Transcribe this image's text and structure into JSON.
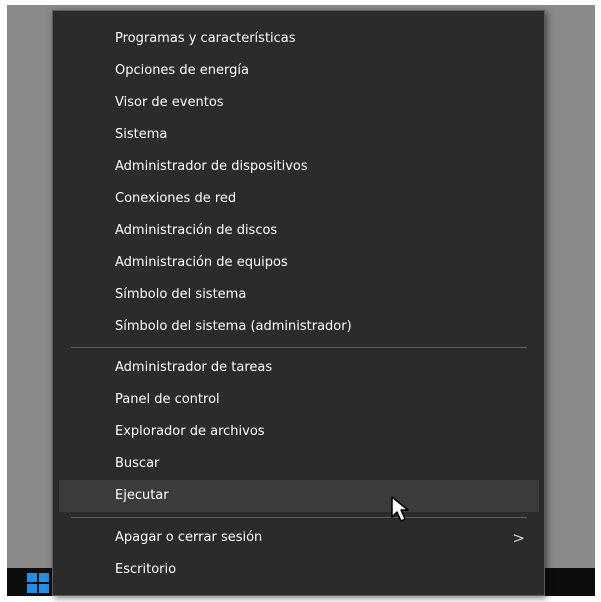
{
  "menu": {
    "group1": [
      {
        "label": "Programas y características"
      },
      {
        "label": "Opciones de energía"
      },
      {
        "label": "Visor de eventos"
      },
      {
        "label": "Sistema"
      },
      {
        "label": "Administrador de dispositivos"
      },
      {
        "label": "Conexiones de red"
      },
      {
        "label": "Administración de discos"
      },
      {
        "label": "Administración de equipos"
      },
      {
        "label": "Símbolo del sistema"
      },
      {
        "label": "Símbolo del sistema (administrador)"
      }
    ],
    "group2": [
      {
        "label": "Administrador de tareas"
      },
      {
        "label": "Panel de control"
      },
      {
        "label": "Explorador de archivos"
      },
      {
        "label": "Buscar"
      },
      {
        "label": "Ejecutar",
        "highlighted": true
      }
    ],
    "group3": [
      {
        "label": "Apagar o cerrar sesión",
        "submenu_arrow": ">"
      },
      {
        "label": "Escritorio"
      }
    ]
  },
  "taskbar": {
    "start_icon": "windows-logo-icon",
    "accent_color": "#1e90e6"
  },
  "cursor": {
    "icon": "mouse-pointer-icon"
  }
}
